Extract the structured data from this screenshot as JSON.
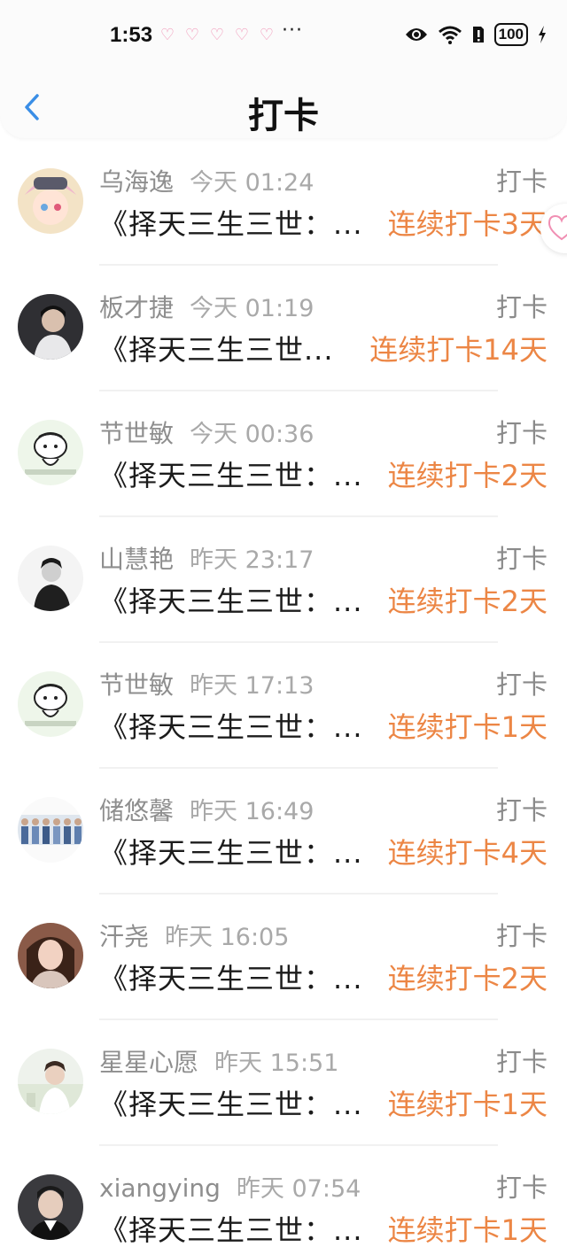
{
  "status_bar": {
    "time": "1:53",
    "dots": "···",
    "battery": "100"
  },
  "header": {
    "title": "打卡"
  },
  "colors": {
    "accent": "#ec8645",
    "back": "#3a8ee6",
    "name": "#8e8e8e",
    "time": "#a9a9a9"
  },
  "entries": [
    {
      "name": "乌海逸",
      "time": "今天 01:24",
      "tag": "打卡",
      "book": "《择天三生三世：...",
      "streak": "连续打卡3天"
    },
    {
      "name": "板才捷",
      "time": "今天 01:19",
      "tag": "打卡",
      "book": "《择天三生三世...",
      "streak": "连续打卡14天"
    },
    {
      "name": "节世敏",
      "time": "今天 00:36",
      "tag": "打卡",
      "book": "《择天三生三世：...",
      "streak": "连续打卡2天"
    },
    {
      "name": "山慧艳",
      "time": "昨天 23:17",
      "tag": "打卡",
      "book": "《择天三生三世：...",
      "streak": "连续打卡2天"
    },
    {
      "name": "节世敏",
      "time": "昨天 17:13",
      "tag": "打卡",
      "book": "《择天三生三世：...",
      "streak": "连续打卡1天"
    },
    {
      "name": "储悠馨",
      "time": "昨天 16:49",
      "tag": "打卡",
      "book": "《择天三生三世：...",
      "streak": "连续打卡4天"
    },
    {
      "name": "汗尧",
      "time": "昨天 16:05",
      "tag": "打卡",
      "book": "《择天三生三世：...",
      "streak": "连续打卡2天"
    },
    {
      "name": "星星心愿",
      "time": "昨天 15:51",
      "tag": "打卡",
      "book": "《择天三生三世：...",
      "streak": "连续打卡1天"
    },
    {
      "name": "xiangying",
      "time": "昨天 07:54",
      "tag": "打卡",
      "book": "《择天三生三世：...",
      "streak": "连续打卡1天"
    }
  ]
}
